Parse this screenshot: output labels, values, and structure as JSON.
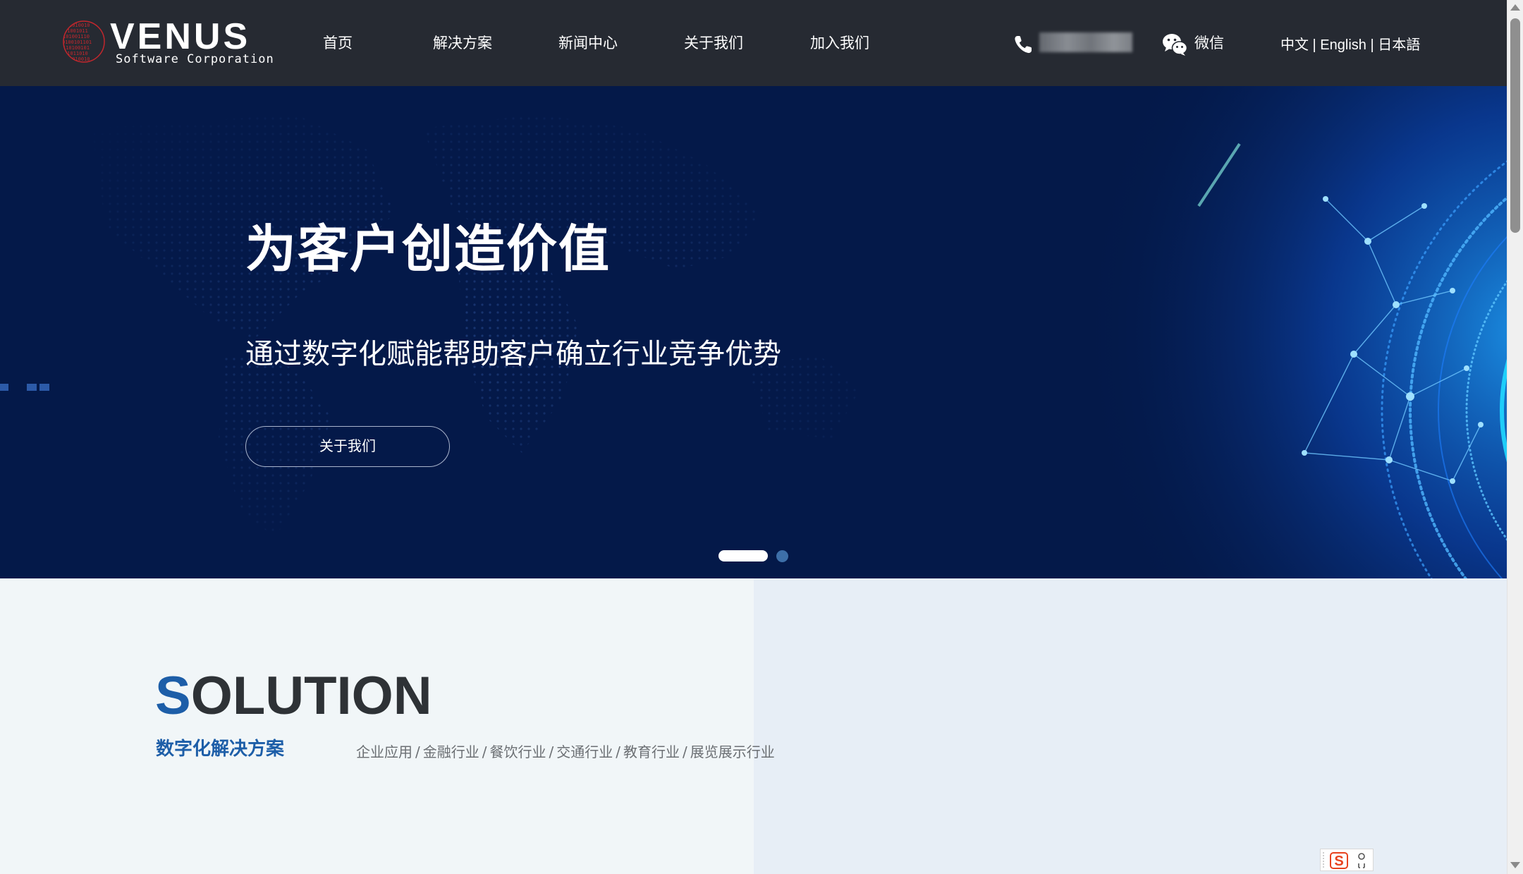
{
  "header": {
    "logo": {
      "name": "VENUS",
      "subtitle": "Software Corporation"
    },
    "nav": [
      {
        "label": "首页"
      },
      {
        "label": "解决方案"
      },
      {
        "label": "新闻中心"
      },
      {
        "label": "关于我们"
      },
      {
        "label": "加入我们"
      }
    ],
    "contact": {
      "phone_icon": "phone-icon",
      "wechat_icon": "wechat-icon",
      "wechat_label": "微信"
    },
    "languages": "中文 | English | 日本語"
  },
  "hero": {
    "title": "为客户创造价值",
    "subtitle": "通过数字化赋能帮助客户确立行业竞争优势",
    "button_label": "关于我们",
    "slides_total": 2,
    "active_slide": 1
  },
  "solution": {
    "heading_first": "S",
    "heading_rest": "OLUTION",
    "subtitle": "数字化解决方案",
    "separator": "/",
    "categories": [
      "企业应用",
      "金融行业",
      "餐饮行业",
      "交通行业",
      "教育行业",
      "展览展示行业"
    ]
  },
  "colors": {
    "header_bg": "#262a32",
    "hero_bg": "#041949",
    "accent_blue": "#1d5ea8",
    "heading_dark": "#2e3236"
  }
}
